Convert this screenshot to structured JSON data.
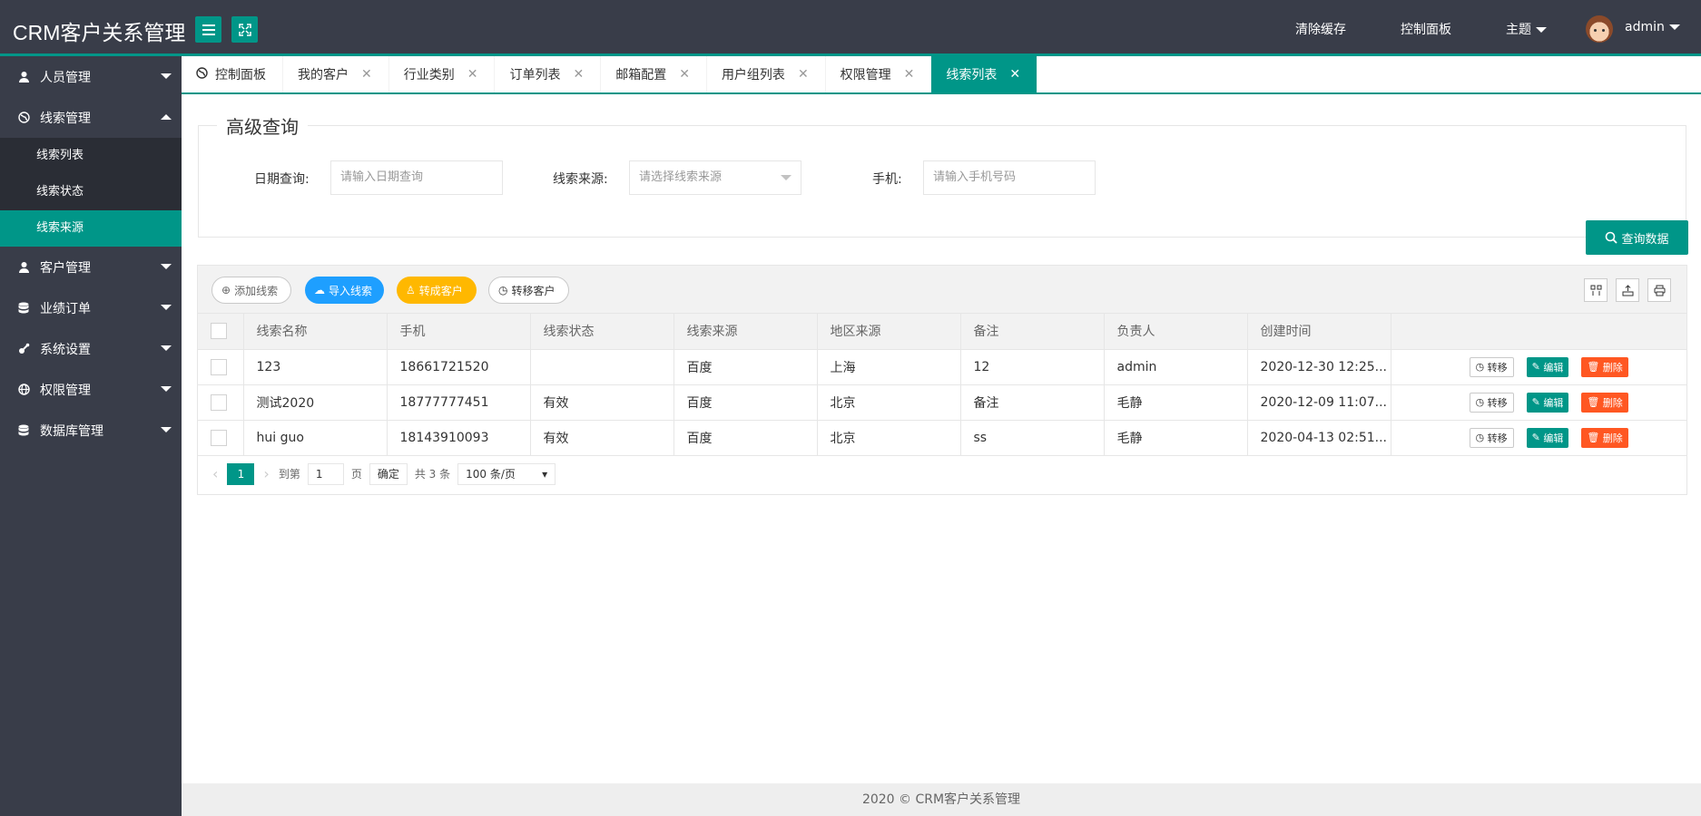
{
  "header": {
    "title": "CRM客户关系管理",
    "clear_cache": "清除缓存",
    "dashboard": "控制面板",
    "theme": "主题",
    "user": "admin"
  },
  "sidebar": {
    "items": [
      {
        "label": "人员管理",
        "icon": "user-icon",
        "expanded": false
      },
      {
        "label": "线索管理",
        "icon": "globe-icon",
        "expanded": true
      },
      {
        "label": "客户管理",
        "icon": "user-icon",
        "expanded": false
      },
      {
        "label": "业绩订单",
        "icon": "database-icon",
        "expanded": false
      },
      {
        "label": "系统设置",
        "icon": "settings-icon",
        "expanded": false
      },
      {
        "label": "权限管理",
        "icon": "globe-icon",
        "expanded": false
      },
      {
        "label": "数据库管理",
        "icon": "database-icon",
        "expanded": false
      }
    ],
    "sub_items": [
      {
        "label": "线索列表",
        "active": false
      },
      {
        "label": "线索状态",
        "active": false
      },
      {
        "label": "线索来源",
        "active": true
      }
    ]
  },
  "tabs": [
    {
      "label": "控制面板",
      "closable": false,
      "active": false
    },
    {
      "label": "我的客户",
      "closable": true,
      "active": false
    },
    {
      "label": "行业类别",
      "closable": true,
      "active": false
    },
    {
      "label": "订单列表",
      "closable": true,
      "active": false
    },
    {
      "label": "邮箱配置",
      "closable": true,
      "active": false
    },
    {
      "label": "用户组列表",
      "closable": true,
      "active": false
    },
    {
      "label": "权限管理",
      "closable": true,
      "active": false
    },
    {
      "label": "线索列表",
      "closable": true,
      "active": true
    }
  ],
  "search": {
    "legend": "高级查询",
    "date_label": "日期查询:",
    "date_placeholder": "请输入日期查询",
    "source_label": "线索来源:",
    "source_placeholder": "请选择线索来源",
    "phone_label": "手机:",
    "phone_placeholder": "请输入手机号码",
    "query_button": "查询数据"
  },
  "toolbar": {
    "add": "添加线索",
    "import": "导入线索",
    "convert": "转成客户",
    "transfer": "转移客户"
  },
  "table": {
    "columns": [
      "线索名称",
      "手机",
      "线索状态",
      "线索来源",
      "地区来源",
      "备注",
      "负责人",
      "创建时间",
      ""
    ],
    "rows": [
      [
        "123",
        "18661721520",
        "",
        "百度",
        "上海",
        "12",
        "admin",
        "2020-12-30 12:25..."
      ],
      [
        "测试2020",
        "18777777451",
        "有效",
        "百度",
        "北京",
        "备注",
        "毛静",
        "2020-12-09 11:07..."
      ],
      [
        "hui guo",
        "18143910093",
        "有效",
        "百度",
        "北京",
        "ss",
        "毛静",
        "2020-04-13 02:51..."
      ]
    ],
    "op_move": "转移",
    "op_edit": "编辑",
    "op_delete": "删除"
  },
  "pager": {
    "current": "1",
    "goto_label": "到第",
    "goto_value": "1",
    "page_unit": "页",
    "confirm": "确定",
    "total": "共 3 条",
    "page_size": "100 条/页"
  },
  "footer": {
    "text": "2020 ©   CRM客户关系管理"
  },
  "colors": {
    "primary": "#009688",
    "dark": "#393d49",
    "blue": "#1e9fff",
    "warm": "#ffb800",
    "danger": "#ff5722"
  }
}
